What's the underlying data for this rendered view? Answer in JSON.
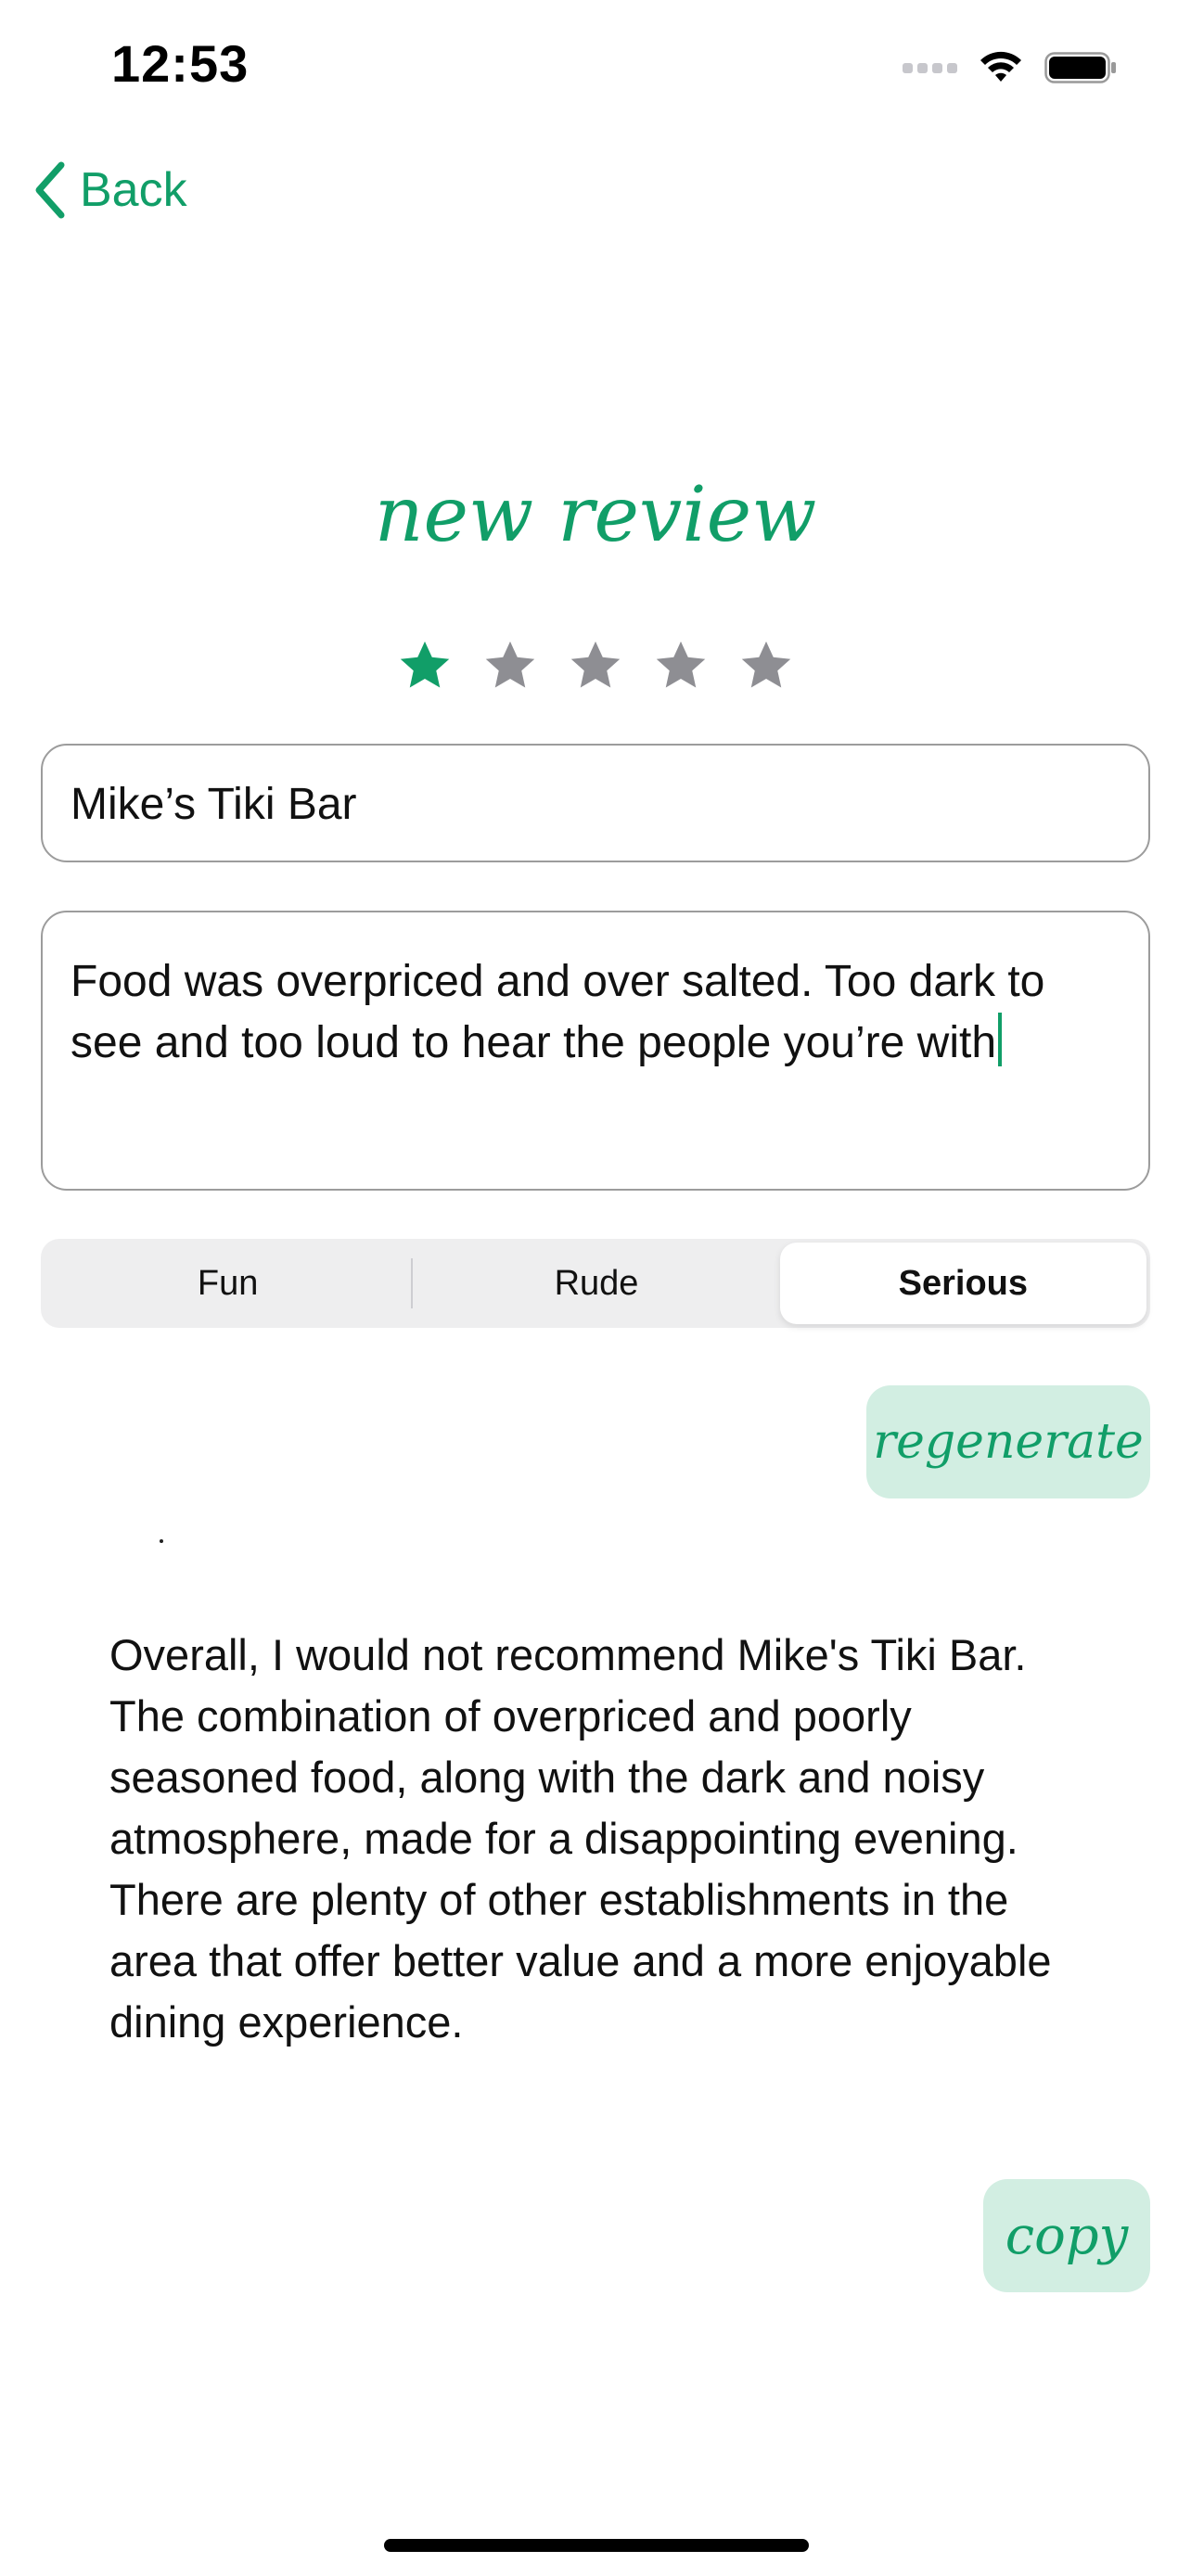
{
  "status_bar": {
    "time": "12:53"
  },
  "nav": {
    "back_label": "Back"
  },
  "screen_title": "new review",
  "rating": {
    "value": 1,
    "max": 5,
    "active_color": "#119e68",
    "inactive_color": "#8e8e93"
  },
  "name_field": {
    "value": "Mike’s Tiki Bar"
  },
  "review_field": {
    "value": "Food was overpriced and over salted. Too dark to see and too loud to hear the people you’re with"
  },
  "tone_segmented": {
    "options": [
      "Fun",
      "Rude",
      "Serious"
    ],
    "selected": "Serious"
  },
  "actions": {
    "regenerate_label": "regenerate",
    "copy_label": "copy"
  },
  "generated_review": "Overall, I would not recommend Mike's Tiki Bar. The combination of overpriced and poorly seasoned food, along with the dark and noisy atmosphere, made for a disappointing evening. There are plenty of other establishments in the area that offer better value and a more enjoyable dining experience.",
  "theme": {
    "accent": "#119e68",
    "button_bg": "#d2eee2"
  }
}
